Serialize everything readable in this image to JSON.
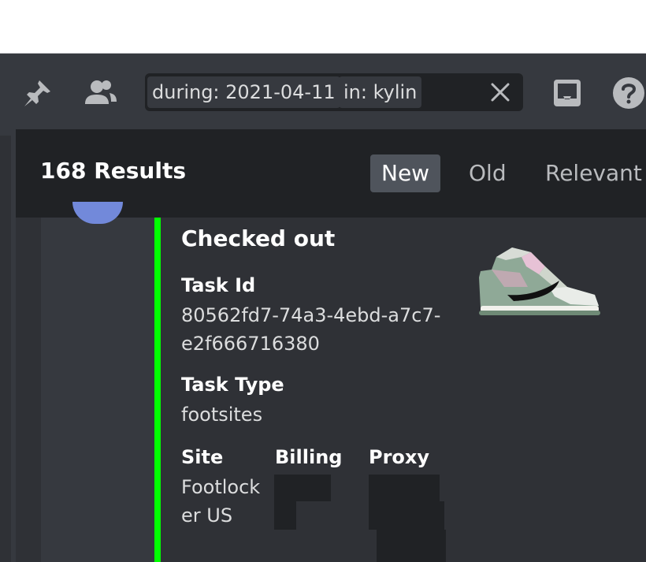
{
  "colors": {
    "app_bg": "#36393f",
    "panel_bg": "#2f3136",
    "header_bg": "#202225",
    "embed_accent": "#00ff00",
    "blurple": "#7289da"
  },
  "toolbar": {
    "icons": [
      "pin-icon",
      "members-icon",
      "inbox-icon",
      "help-icon"
    ],
    "search": {
      "chips": [
        "during: 2021-04-11",
        "in: kylin"
      ],
      "clear_icon": "close-icon"
    }
  },
  "results": {
    "count_label": "168 Results",
    "sort_options": [
      "New",
      "Old",
      "Relevant"
    ],
    "active_sort": "New"
  },
  "embed": {
    "title": "Checked out",
    "fields": {
      "task_id": {
        "name": "Task Id",
        "value_line1": "80562fd7-74a3-4ebd-a7c7-",
        "value_line2": "e2f666716380"
      },
      "task_type": {
        "name": "Task Type",
        "value": "footsites"
      },
      "site": {
        "name": "Site",
        "value_line1": "Footlock",
        "value_line2": "er US"
      },
      "billing": {
        "name": "Billing"
      },
      "proxy": {
        "name": "Proxy"
      }
    },
    "thumbnail": "sneaker-image"
  }
}
